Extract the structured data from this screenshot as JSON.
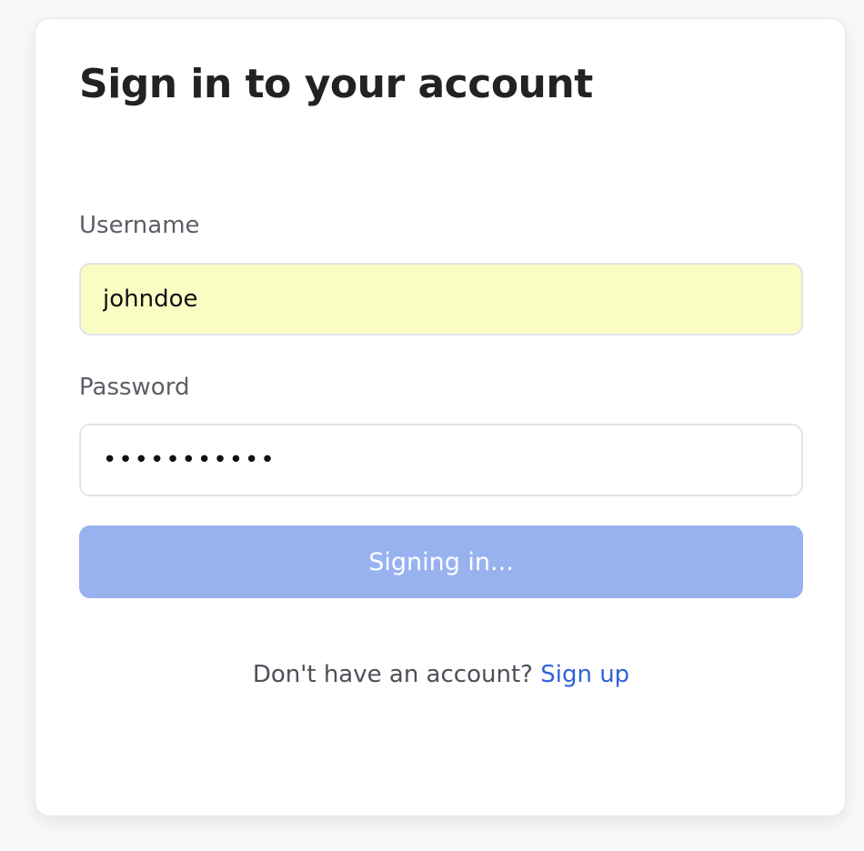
{
  "auth": {
    "title": "Sign in to your account",
    "username_label": "Username",
    "username_value": "johndoe",
    "password_label": "Password",
    "password_value": "•••••••••••",
    "submit_label": "Signing in...",
    "signup_prompt": "Don't have an account?",
    "signup_link": "Sign up"
  },
  "colors": {
    "accent": "#98b2f0",
    "link": "#2f63d8",
    "autofill_bg": "#fafdc3"
  }
}
